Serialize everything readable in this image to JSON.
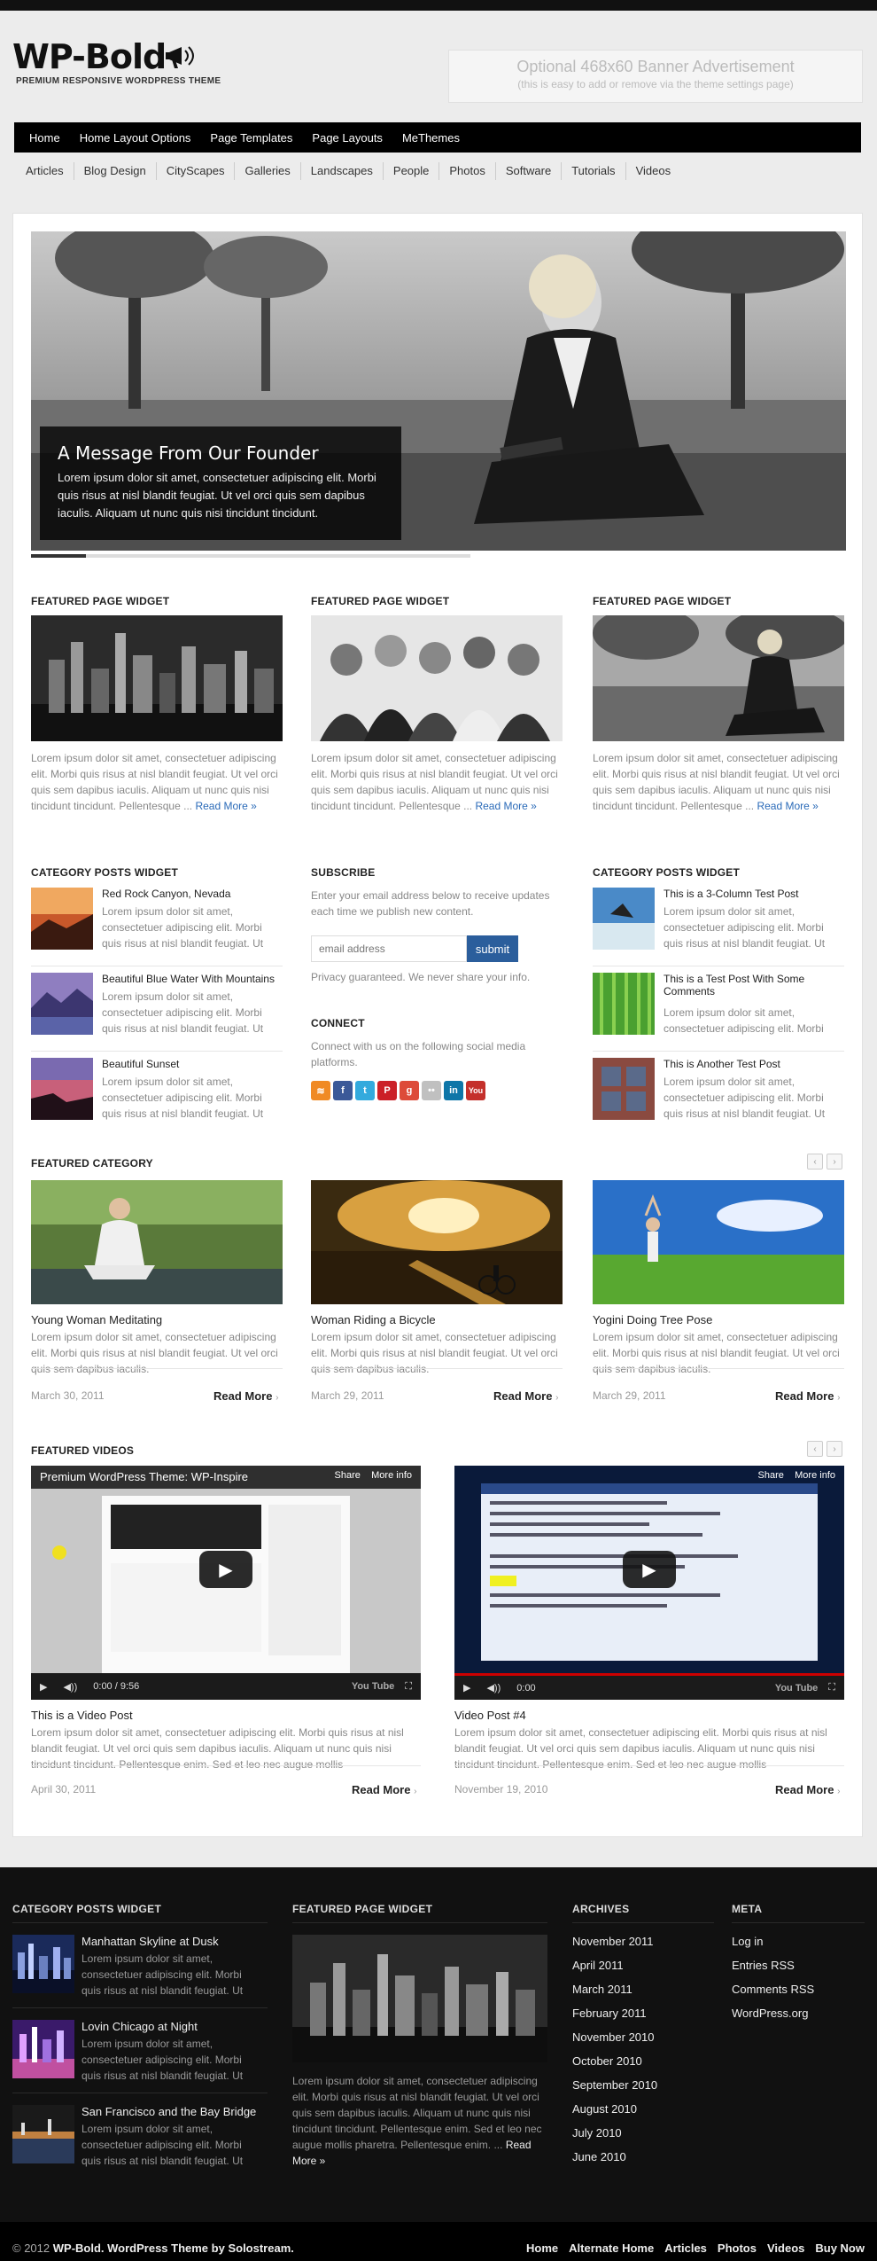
{
  "site": {
    "logo_text": "WP-Bold",
    "tagline": "PREMIUM RESPONSIVE WORDPRESS THEME",
    "banner_line1": "Optional 468x60 Banner Advertisement",
    "banner_line2": "(this is easy to add or remove via the theme settings page)"
  },
  "nav_primary": [
    "Home",
    "Home Layout Options",
    "Page Templates",
    "Page Layouts",
    "MeThemes"
  ],
  "nav_secondary": [
    "Articles",
    "Blog Design",
    "CityScapes",
    "Galleries",
    "Landscapes",
    "People",
    "Photos",
    "Software",
    "Tutorials",
    "Videos"
  ],
  "slider": {
    "title": "A Message From Our Founder",
    "text": "Lorem ipsum dolor sit amet, consectetuer adipiscing elit. Morbi quis risus at nisl blandit feugiat. Ut vel orci quis sem dapibus iaculis. Aliquam ut nunc quis nisi tincidunt tincidunt."
  },
  "featured_pages": [
    {
      "title": "FEATURED PAGE WIDGET",
      "text": "Lorem ipsum dolor sit amet, consectetuer adipiscing elit. Morbi quis risus at nisl blandit feugiat. Ut vel orci quis sem dapibus iaculis. Aliquam ut nunc quis nisi tincidunt tincidunt. Pellentesque ...",
      "link": "Read More »"
    },
    {
      "title": "FEATURED PAGE WIDGET",
      "text": "Lorem ipsum dolor sit amet, consectetuer adipiscing elit. Morbi quis risus at nisl blandit feugiat. Ut vel orci quis sem dapibus iaculis. Aliquam ut nunc quis nisi tincidunt tincidunt. Pellentesque ...",
      "link": "Read More »"
    },
    {
      "title": "FEATURED PAGE WIDGET",
      "text": "Lorem ipsum dolor sit amet, consectetuer adipiscing elit. Morbi quis risus at nisl blandit feugiat. Ut vel orci quis sem dapibus iaculis. Aliquam ut nunc quis nisi tincidunt tincidunt. Pellentesque ...",
      "link": "Read More »"
    }
  ],
  "cat_left": {
    "title": "CATEGORY POSTS WIDGET",
    "items": [
      {
        "title": "Red Rock Canyon, Nevada",
        "text": "Lorem ipsum dolor sit amet, consectetuer adipiscing elit. Morbi quis risus at nisl blandit feugiat. Ut"
      },
      {
        "title": "Beautiful Blue Water With Mountains",
        "text": "Lorem ipsum dolor sit amet, consectetuer adipiscing elit. Morbi quis risus at nisl blandit feugiat. Ut"
      },
      {
        "title": "Beautiful Sunset",
        "text": "Lorem ipsum dolor sit amet, consectetuer adipiscing elit. Morbi quis risus at nisl blandit feugiat. Ut"
      }
    ]
  },
  "subscribe": {
    "title": "SUBSCRIBE",
    "text": "Enter your email address below to receive updates each time we publish new content.",
    "placeholder": "email address",
    "button": "submit",
    "privacy": "Privacy guaranteed. We never share your info."
  },
  "connect": {
    "title": "CONNECT",
    "text": "Connect with us on the following social media platforms."
  },
  "cat_right": {
    "title": "CATEGORY POSTS WIDGET",
    "items": [
      {
        "title": "This is a 3-Column Test Post",
        "text": "Lorem ipsum dolor sit amet, consectetuer adipiscing elit. Morbi quis risus at nisl blandit feugiat. Ut"
      },
      {
        "title": "This is a Test Post With Some Comments",
        "text": "Lorem ipsum dolor sit amet, consectetuer adipiscing elit. Morbi"
      },
      {
        "title": "This is Another Test Post",
        "text": "Lorem ipsum dolor sit amet, consectetuer adipiscing elit. Morbi quis risus at nisl blandit feugiat. Ut"
      }
    ]
  },
  "featured_category": {
    "title": "FEATURED CATEGORY",
    "items": [
      {
        "title": "Young Woman Meditating",
        "text": "Lorem ipsum dolor sit amet, consectetuer adipiscing elit. Morbi quis risus at nisl blandit feugiat. Ut vel orci quis sem dapibus iaculis.",
        "date": "March 30, 2011",
        "more": "Read More"
      },
      {
        "title": "Woman Riding a Bicycle",
        "text": "Lorem ipsum dolor sit amet, consectetuer adipiscing elit. Morbi quis risus at nisl blandit feugiat. Ut vel orci quis sem dapibus iaculis.",
        "date": "March 29, 2011",
        "more": "Read More"
      },
      {
        "title": "Yogini Doing Tree Pose",
        "text": "Lorem ipsum dolor sit amet, consectetuer adipiscing elit. Morbi quis risus at nisl blandit feugiat. Ut vel orci quis sem dapibus iaculis.",
        "date": "March 29, 2011",
        "more": "Read More"
      }
    ]
  },
  "featured_videos": {
    "title": "FEATURED VIDEOS",
    "items": [
      {
        "video_title": "Premium WordPress Theme: WP-Inspire",
        "share": "Share",
        "more_info": "More info",
        "time": "0:00 / 9:56",
        "title": "This is a Video Post",
        "text": "Lorem ipsum dolor sit amet, consectetuer adipiscing elit. Morbi quis risus at nisl blandit feugiat. Ut vel orci quis sem dapibus iaculis. Aliquam ut nunc quis nisi tincidunt tincidunt. Pellentesque enim. Sed et leo nec augue mollis",
        "date": "April 30, 2011",
        "more": "Read More"
      },
      {
        "video_title": "",
        "share": "Share",
        "more_info": "More info",
        "time": "0:00",
        "title": "Video Post #4",
        "text": "Lorem ipsum dolor sit amet, consectetuer adipiscing elit. Morbi quis risus at nisl blandit feugiat. Ut vel orci quis sem dapibus iaculis. Aliquam ut nunc quis nisi tincidunt tincidunt. Pellentesque enim. Sed et leo nec augue mollis",
        "date": "November 19, 2010",
        "more": "Read More"
      }
    ]
  },
  "footer": {
    "cat": {
      "title": "CATEGORY POSTS WIDGET",
      "items": [
        {
          "title": "Manhattan Skyline at Dusk",
          "text": "Lorem ipsum dolor sit amet, consectetuer adipiscing elit. Morbi quis risus at nisl blandit feugiat. Ut"
        },
        {
          "title": "Lovin Chicago at Night",
          "text": "Lorem ipsum dolor sit amet, consectetuer adipiscing elit. Morbi quis risus at nisl blandit feugiat. Ut"
        },
        {
          "title": "San Francisco and the Bay Bridge",
          "text": "Lorem ipsum dolor sit amet, consectetuer adipiscing elit. Morbi quis risus at nisl blandit feugiat. Ut"
        }
      ]
    },
    "page": {
      "title": "FEATURED PAGE WIDGET",
      "text": "Lorem ipsum dolor sit amet, consectetuer adipiscing elit. Morbi quis risus at nisl blandit feugiat. Ut vel orci quis sem dapibus iaculis. Aliquam ut nunc quis nisi tincidunt tincidunt. Pellentesque enim. Sed et leo nec augue mollis pharetra. Pellentesque enim. ...",
      "link": "Read More »"
    },
    "archives": {
      "title": "ARCHIVES",
      "items": [
        "November 2011",
        "April 2011",
        "March 2011",
        "February 2011",
        "November 2010",
        "October 2010",
        "September 2010",
        "August 2010",
        "July 2010",
        "June 2010"
      ]
    },
    "meta": {
      "title": "META",
      "items": [
        "Log in",
        "Entries RSS",
        "Comments RSS",
        "WordPress.org"
      ]
    }
  },
  "bottom": {
    "copyright_pre": "© 2012",
    "copyright_site": "WP-Bold",
    "copyright_post": ". WordPress Theme by",
    "copyright_author": "Solostream.",
    "nav": [
      "Home",
      "Alternate Home",
      "Articles",
      "Photos",
      "Videos",
      "Buy Now"
    ]
  },
  "colors": {
    "link": "#2a6ab8",
    "submit": "#2b5e9c",
    "nav_bg": "#000000",
    "footer_bg": "#111111"
  }
}
